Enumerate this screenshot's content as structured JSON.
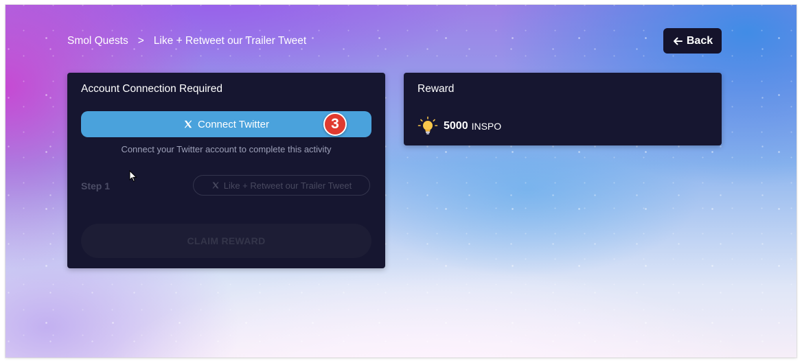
{
  "breadcrumb": {
    "root": "Smol Quests",
    "separator": ">",
    "current": "Like + Retweet our Trailer Tweet"
  },
  "header": {
    "back_label": "Back",
    "back_icon": "arrow-left-icon"
  },
  "quest_card": {
    "title": "Account Connection Required",
    "connect_button_label": "Connect Twitter",
    "connect_icon": "x-logo-icon",
    "step_badge": "3",
    "hint": "Connect your Twitter account to complete this activity",
    "step_label": "Step 1",
    "step_button_label": "Like + Retweet our Trailer Tweet",
    "claim_button_label": "CLAIM REWARD"
  },
  "reward_card": {
    "title": "Reward",
    "icon": "lightbulb-icon",
    "amount": "5000",
    "unit": "INSPO"
  },
  "colors": {
    "card_bg": "#161630",
    "connect_button": "#4aa2dc",
    "badge": "#e03a2f",
    "back_button": "#15132b"
  }
}
